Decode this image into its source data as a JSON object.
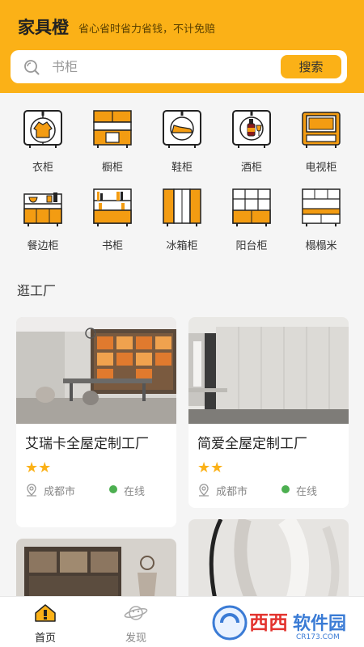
{
  "header": {
    "brand": "家具橙",
    "slogan": "省心省时省力省钱，不计免赔"
  },
  "search": {
    "placeholder": "书柜",
    "button_label": "搜索"
  },
  "categories": [
    {
      "label": "衣柜",
      "icon": "wardrobe-icon"
    },
    {
      "label": "橱柜",
      "icon": "kitchen-cabinet-icon"
    },
    {
      "label": "鞋柜",
      "icon": "shoe-cabinet-icon"
    },
    {
      "label": "酒柜",
      "icon": "wine-cabinet-icon"
    },
    {
      "label": "电视柜",
      "icon": "tv-cabinet-icon"
    },
    {
      "label": "餐边柜",
      "icon": "sideboard-icon"
    },
    {
      "label": "书柜",
      "icon": "bookcase-icon"
    },
    {
      "label": "冰箱柜",
      "icon": "fridge-cabinet-icon"
    },
    {
      "label": "阳台柜",
      "icon": "balcony-cabinet-icon"
    },
    {
      "label": "榻榻米",
      "icon": "tatami-icon"
    }
  ],
  "section": {
    "title": "逛工厂"
  },
  "factories": [
    {
      "name": "艾瑞卡全屋定制工厂",
      "rating": 2,
      "stars": "★★",
      "city": "成都市",
      "status": "在线"
    },
    {
      "name": "简爱全屋定制工厂",
      "rating": 2,
      "stars": "★★",
      "city": "成都市",
      "status": "在线"
    }
  ],
  "tabbar": {
    "tabs": [
      {
        "label": "首页",
        "icon": "home-icon",
        "active": true
      },
      {
        "label": "发现",
        "icon": "planet-icon",
        "active": false
      }
    ]
  },
  "watermark": "西西软件园 CR173.COM",
  "colors": {
    "accent": "#fbb117",
    "online": "#4caf50"
  }
}
